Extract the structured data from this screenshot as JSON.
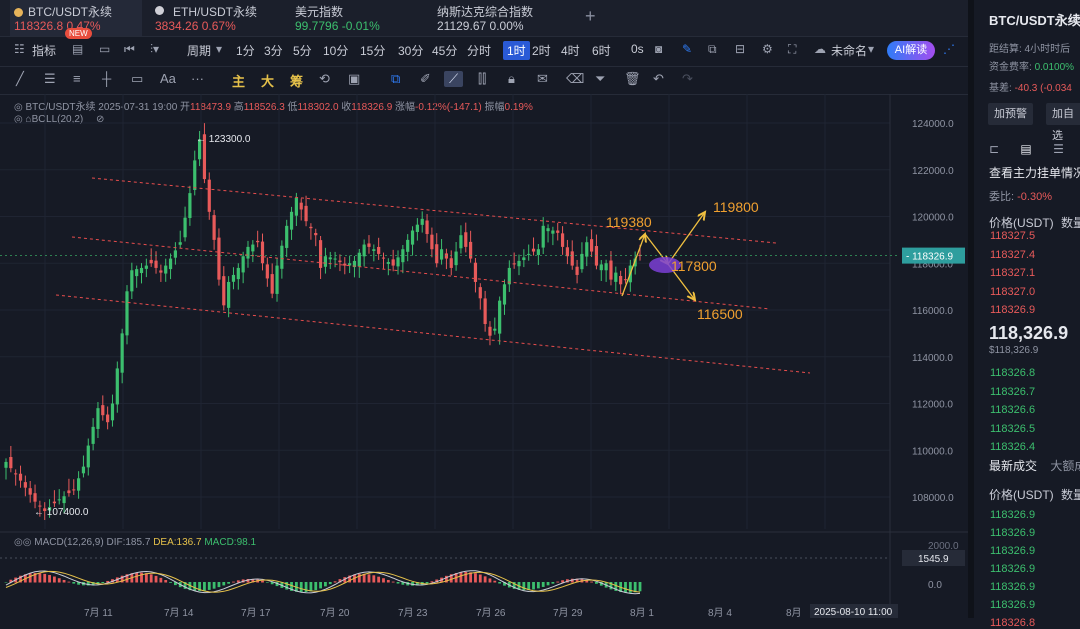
{
  "tabs": [
    {
      "name": "BTC/USDT永续",
      "price": "118326.8",
      "change": "0.47%",
      "badge": "NEW",
      "dot_color": "#e6b35a"
    },
    {
      "name": "ETH/USDT永续",
      "price": "3834.26",
      "change": "0.67%",
      "dot_color": "#cfcfd6"
    },
    {
      "name": "美元指数",
      "price": "99.7796",
      "change": "-0.01%"
    },
    {
      "name": "纳斯达克综合指数",
      "price": "21129.67",
      "change": "0.00%"
    }
  ],
  "toolbar": {
    "indicators": "指标",
    "period": "周期",
    "intervals": [
      "1分",
      "3分",
      "5分",
      "10分",
      "15分",
      "30分",
      "45分",
      "分时",
      "1时",
      "2时",
      "4时",
      "6时",
      "0s"
    ],
    "active_interval": "1时",
    "cloud": "未命名",
    "ai": "AI解读"
  },
  "draw_toolbar": {
    "aa": "Aa",
    "more": "···",
    "zhu": "主",
    "da": "大",
    "chou": "筹"
  },
  "chart_header": {
    "symbol": "BTC/USDT永续",
    "datetime": "2025-07-31 19:00",
    "open_label": "开",
    "open": "118473.9",
    "high_label": "高",
    "high": "118526.3",
    "low_label": "低",
    "low": "118302.0",
    "close_label": "收",
    "close": "118326.9",
    "change_label": "涨幅",
    "change": "-0.12%(-147.1)",
    "amp_label": "振幅",
    "amp": "0.19%",
    "boll": "BOLL(20,2)"
  },
  "macd": {
    "label": "MACD(12,26,9)",
    "dif": "DIF:185.7",
    "dea": "DEA:136.7",
    "macd": "MACD:98.1",
    "value_tag": "1545.9",
    "zero": "0.0",
    "top": "2000.0"
  },
  "chart_data": {
    "type": "candlestick",
    "y_ticks": [
      "124000.0",
      "122000.0",
      "120000.0",
      "118000.0",
      "116000.0",
      "114000.0",
      "112000.0",
      "110000.0",
      "108000.0"
    ],
    "x_ticks": [
      "7月 11",
      "7月 14",
      "7月 17",
      "7月 20",
      "7月 23",
      "7月 26",
      "7月 29",
      "8月 1",
      "8月 4",
      "8月"
    ],
    "time_tag": "2025-08-10 11:00",
    "last_price": "118326.9",
    "high_label": "← 123300.0",
    "low_label": "← 107400.0",
    "annotations": [
      "119380",
      "119800",
      "117800",
      "116500"
    ],
    "close_path": [
      [
        0,
        109500
      ],
      [
        3,
        108700
      ],
      [
        6,
        107800
      ],
      [
        8,
        107400
      ],
      [
        11,
        107900
      ],
      [
        14,
        108300
      ],
      [
        16,
        109300
      ],
      [
        17,
        110200
      ],
      [
        18,
        111000
      ],
      [
        19,
        111800
      ],
      [
        20,
        111500
      ],
      [
        21,
        111200
      ],
      [
        22,
        112000
      ],
      [
        23,
        113500
      ],
      [
        24,
        115000
      ],
      [
        25,
        116800
      ],
      [
        26,
        117700
      ],
      [
        28,
        117800
      ],
      [
        30,
        118000
      ],
      [
        32,
        117600
      ],
      [
        34,
        118200
      ],
      [
        36,
        118900
      ],
      [
        38,
        121000
      ],
      [
        39,
        122400
      ],
      [
        40,
        123300
      ],
      [
        41,
        121600
      ],
      [
        42,
        120200
      ],
      [
        43,
        119000
      ],
      [
        44,
        117300
      ],
      [
        45,
        116200
      ],
      [
        46,
        117200
      ],
      [
        48,
        117800
      ],
      [
        49,
        118300
      ],
      [
        50,
        118700
      ],
      [
        52,
        118900
      ],
      [
        53,
        118000
      ],
      [
        55,
        116700
      ],
      [
        56,
        117900
      ],
      [
        58,
        119600
      ],
      [
        59,
        120200
      ],
      [
        60,
        120800
      ],
      [
        62,
        119800
      ],
      [
        64,
        119200
      ],
      [
        65,
        117800
      ],
      [
        66,
        118300
      ],
      [
        68,
        118200
      ],
      [
        70,
        117900
      ],
      [
        72,
        118100
      ],
      [
        74,
        118800
      ],
      [
        76,
        118600
      ],
      [
        78,
        118200
      ],
      [
        80,
        117900
      ],
      [
        82,
        118600
      ],
      [
        84,
        119400
      ],
      [
        86,
        119900
      ],
      [
        88,
        118600
      ],
      [
        89,
        118000
      ],
      [
        90,
        118600
      ],
      [
        92,
        117800
      ],
      [
        94,
        119200
      ],
      [
        96,
        118200
      ],
      [
        97,
        117200
      ],
      [
        98,
        116500
      ],
      [
        99,
        115400
      ],
      [
        100,
        114900
      ],
      [
        101,
        115200
      ],
      [
        102,
        116400
      ],
      [
        104,
        117800
      ],
      [
        106,
        118100
      ],
      [
        108,
        118400
      ],
      [
        110,
        118600
      ],
      [
        111,
        119600
      ],
      [
        112,
        119500
      ],
      [
        114,
        119300
      ],
      [
        115,
        118700
      ],
      [
        116,
        118300
      ],
      [
        118,
        117500
      ],
      [
        119,
        118400
      ],
      [
        120,
        118900
      ],
      [
        121,
        118500
      ],
      [
        122,
        117900
      ],
      [
        124,
        118000
      ],
      [
        125,
        117300
      ],
      [
        126,
        117600
      ],
      [
        127,
        117100
      ],
      [
        128,
        117300
      ],
      [
        129,
        117900
      ],
      [
        130,
        118200
      ],
      [
        131,
        118326
      ]
    ]
  },
  "right_panel": {
    "title": "BTC/USDT永续",
    "expiry": "距结算: 4小时时后",
    "funding_label": "资金费率:",
    "funding": "0.0100%",
    "basis_label": "基差:",
    "basis": "-40.3 (-0.034",
    "btn1": "加预警",
    "btn2": "加自选",
    "depth_title": "查看主力挂单情况",
    "ratio_label": "委比:",
    "ratio": "-0.30%",
    "col_price": "价格(USDT)",
    "col_qty": "数量",
    "asks": [
      "118327.5",
      "118327.4",
      "118327.1",
      "118327.0",
      "118326.9"
    ],
    "last": "118,326.9",
    "last_sub": "$118,326.9",
    "bids": [
      "118326.8",
      "118326.7",
      "118326.6",
      "118326.5",
      "118326.4"
    ],
    "trades_tab1": "最新成交",
    "trades_tab2": "大额成",
    "trades": [
      "118326.9",
      "118326.9",
      "118326.9",
      "118326.9",
      "118326.9",
      "118326.9",
      "118326.8"
    ],
    "trade_colors": [
      "#3cbf6e",
      "#3cbf6e",
      "#3cbf6e",
      "#3cbf6e",
      "#3cbf6e",
      "#3cbf6e",
      "#e85a5a"
    ]
  },
  "colors": {
    "accent": "#2a5ad6",
    "up": "#3cbf6e",
    "down": "#e85a5a",
    "annot": "#f0a030",
    "bg": "#161a25"
  }
}
